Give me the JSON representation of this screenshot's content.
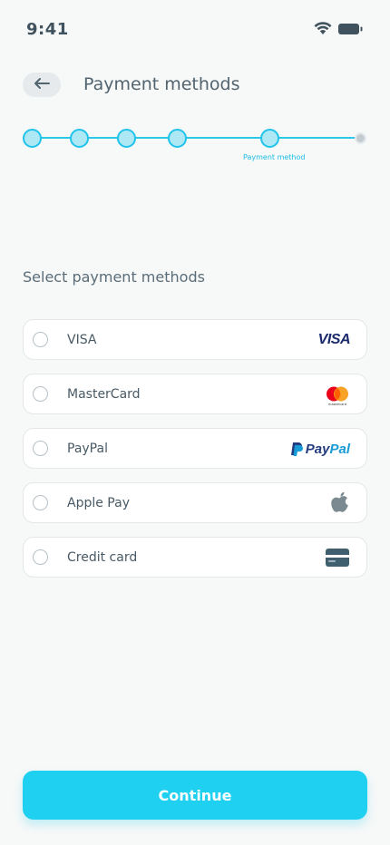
{
  "status_bar": {
    "time": "9:41"
  },
  "header": {
    "title": "Payment methods"
  },
  "stepper": {
    "active_caption": "Payment method",
    "accent_color": "#1fc5ea"
  },
  "section": {
    "title": "Select payment methods"
  },
  "methods": [
    {
      "label": "VISA",
      "logo": "visa-logo",
      "logo_text": "VISA"
    },
    {
      "label": "MasterCard",
      "logo": "mastercard-logo",
      "logo_text": "mastercard"
    },
    {
      "label": "PayPal",
      "logo": "paypal-logo",
      "logo_text_a": "Pay",
      "logo_text_b": "Pal"
    },
    {
      "label": "Apple Pay",
      "logo": "apple-icon"
    },
    {
      "label": "Credit card",
      "logo": "credit-card-icon"
    }
  ],
  "footer": {
    "continue_label": "Continue",
    "button_color": "#1fd0f1"
  }
}
